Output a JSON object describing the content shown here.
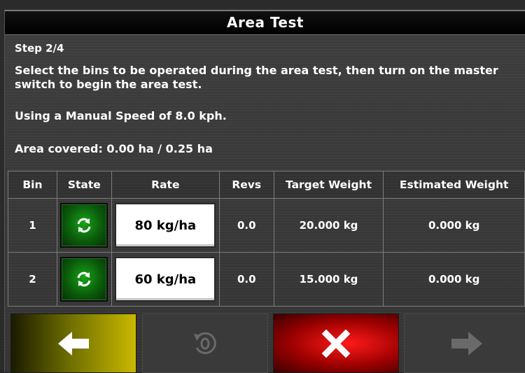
{
  "dialog": {
    "title": "Area Test",
    "step": "Step 2/4",
    "instruction": "Select the bins to be operated during the area test, then turn on the master switch to begin the area test.",
    "speed_text": "Using a Manual Speed of 8.0 kph.",
    "area_text": "Area covered: 0.00 ha / 0.25 ha"
  },
  "table": {
    "headers": [
      "Bin",
      "State",
      "Rate",
      "Revs",
      "Target Weight",
      "Estimated Weight"
    ],
    "rows": [
      {
        "bin": "1",
        "state_icon": "refresh-icon",
        "rate": "80 kg/ha",
        "revs": "0.0",
        "target_weight": "20.000 kg",
        "estimated_weight": "0.000 kg"
      },
      {
        "bin": "2",
        "state_icon": "refresh-icon",
        "rate": "60 kg/ha",
        "revs": "0.0",
        "target_weight": "15.000 kg",
        "estimated_weight": "0.000 kg"
      }
    ]
  },
  "nav": {
    "back_icon": "arrow-left-icon",
    "reset_icon": "reset-zero-icon",
    "cancel_icon": "close-icon",
    "next_icon": "arrow-right-icon"
  },
  "colors": {
    "title_bar": "#000000",
    "state_active": "#17a317",
    "back_button": "#c9b800",
    "cancel_button": "#ff1a1a",
    "disabled_button": "#3a3a3a"
  }
}
